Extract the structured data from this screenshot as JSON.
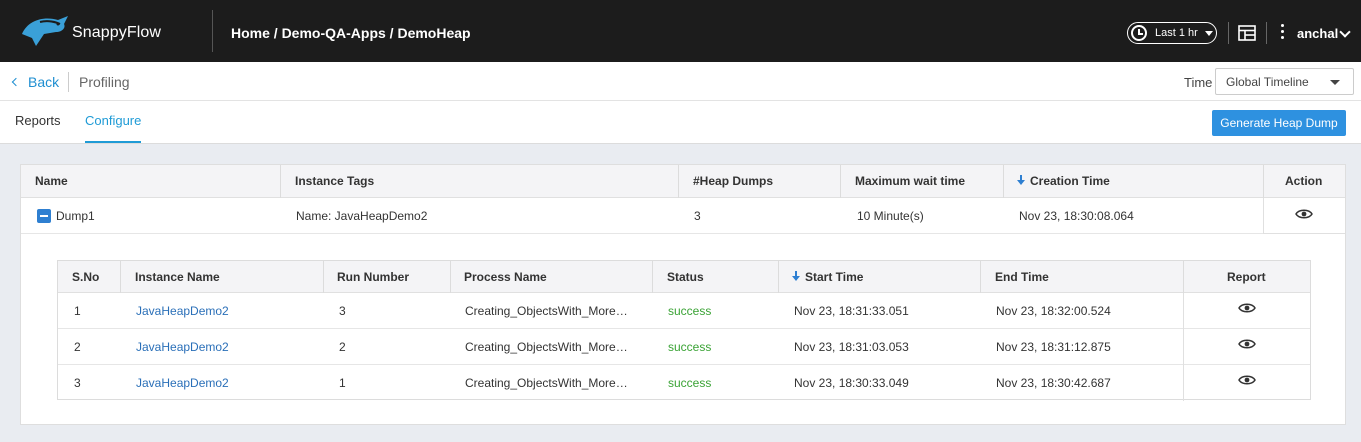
{
  "topbar": {
    "brand": "SnappyFlow",
    "breadcrumb": "Home / Demo-QA-Apps / DemoHeap",
    "time_range": "Last 1 hr",
    "user": "anchal"
  },
  "subheader": {
    "back_label": "Back",
    "page_title": "Profiling",
    "time_label": "Time",
    "timeline_value": "Global Timeline"
  },
  "tabs": [
    {
      "label": "Reports",
      "active": false
    },
    {
      "label": "Configure",
      "active": true
    }
  ],
  "actions": {
    "generate_label": "Generate Heap Dump"
  },
  "main_table": {
    "headers": {
      "name": "Name",
      "instance_tags": "Instance Tags",
      "heap_dumps": "#Heap Dumps",
      "max_wait": "Maximum wait time",
      "creation_time": "Creation Time",
      "action": "Action"
    },
    "row": {
      "name": "Dump1",
      "instance_tags": "Name: JavaHeapDemo2",
      "heap_dumps": "3",
      "max_wait": "10 Minute(s)",
      "creation_time": "Nov 23, 18:30:08.064"
    }
  },
  "sub_table": {
    "headers": {
      "sno": "S.No",
      "instance_name": "Instance Name",
      "run_number": "Run Number",
      "process_name": "Process Name",
      "status": "Status",
      "start_time": "Start Time",
      "end_time": "End Time",
      "report": "Report"
    },
    "rows": [
      {
        "sno": "1",
        "instance_name": "JavaHeapDemo2",
        "run_number": "3",
        "process_name": "Creating_ObjectsWith_More…",
        "status": "success",
        "start_time": "Nov 23, 18:31:33.051",
        "end_time": "Nov 23, 18:32:00.524"
      },
      {
        "sno": "2",
        "instance_name": "JavaHeapDemo2",
        "run_number": "2",
        "process_name": "Creating_ObjectsWith_More…",
        "status": "success",
        "start_time": "Nov 23, 18:31:03.053",
        "end_time": "Nov 23, 18:31:12.875"
      },
      {
        "sno": "3",
        "instance_name": "JavaHeapDemo2",
        "run_number": "1",
        "process_name": "Creating_ObjectsWith_More…",
        "status": "success",
        "start_time": "Nov 23, 18:30:33.049",
        "end_time": "Nov 23, 18:30:42.687"
      }
    ]
  },
  "colors": {
    "accent": "#1f9bd6",
    "primary_button": "#2e91e0",
    "success": "#3aa335",
    "link": "#2a6fb8",
    "topbar": "#1c1c1c"
  },
  "icons": {
    "clock": "clock-icon",
    "layout": "layout-icon",
    "more": "kebab-icon",
    "view": "eye-icon",
    "collapse": "minus-square-icon",
    "sort": "arrow-down-icon"
  }
}
